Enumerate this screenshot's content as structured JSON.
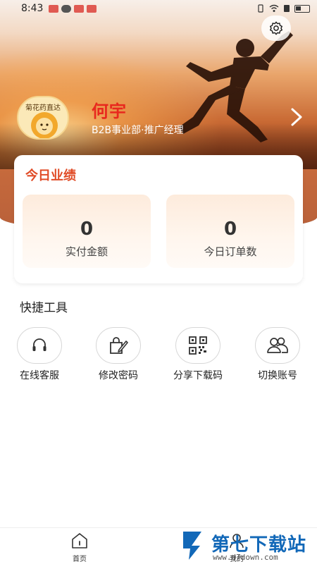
{
  "status_bar": {
    "time": "8:43"
  },
  "profile": {
    "avatar_text": "菊花药直达",
    "name": "何宇",
    "role": "B2B事业部·推广经理"
  },
  "performance": {
    "title": "今日业绩",
    "stats": [
      {
        "value": "0",
        "label": "实付金额"
      },
      {
        "value": "0",
        "label": "今日订单数"
      }
    ]
  },
  "tools": {
    "title": "快捷工具",
    "items": [
      {
        "label": "在线客服",
        "icon": "headset-icon"
      },
      {
        "label": "修改密码",
        "icon": "edit-password-icon"
      },
      {
        "label": "分享下载码",
        "icon": "qr-code-icon"
      },
      {
        "label": "切换账号",
        "icon": "switch-account-icon"
      }
    ]
  },
  "nav": {
    "items": [
      {
        "label": "首页",
        "icon": "home-icon"
      },
      {
        "label": "我的",
        "icon": "profile-icon"
      }
    ]
  },
  "watermark": {
    "title": "第七下载站",
    "url": "www.d7down.com"
  },
  "colors": {
    "accent": "#e04b26",
    "name": "#e8281e",
    "watermark": "#1268b8"
  }
}
